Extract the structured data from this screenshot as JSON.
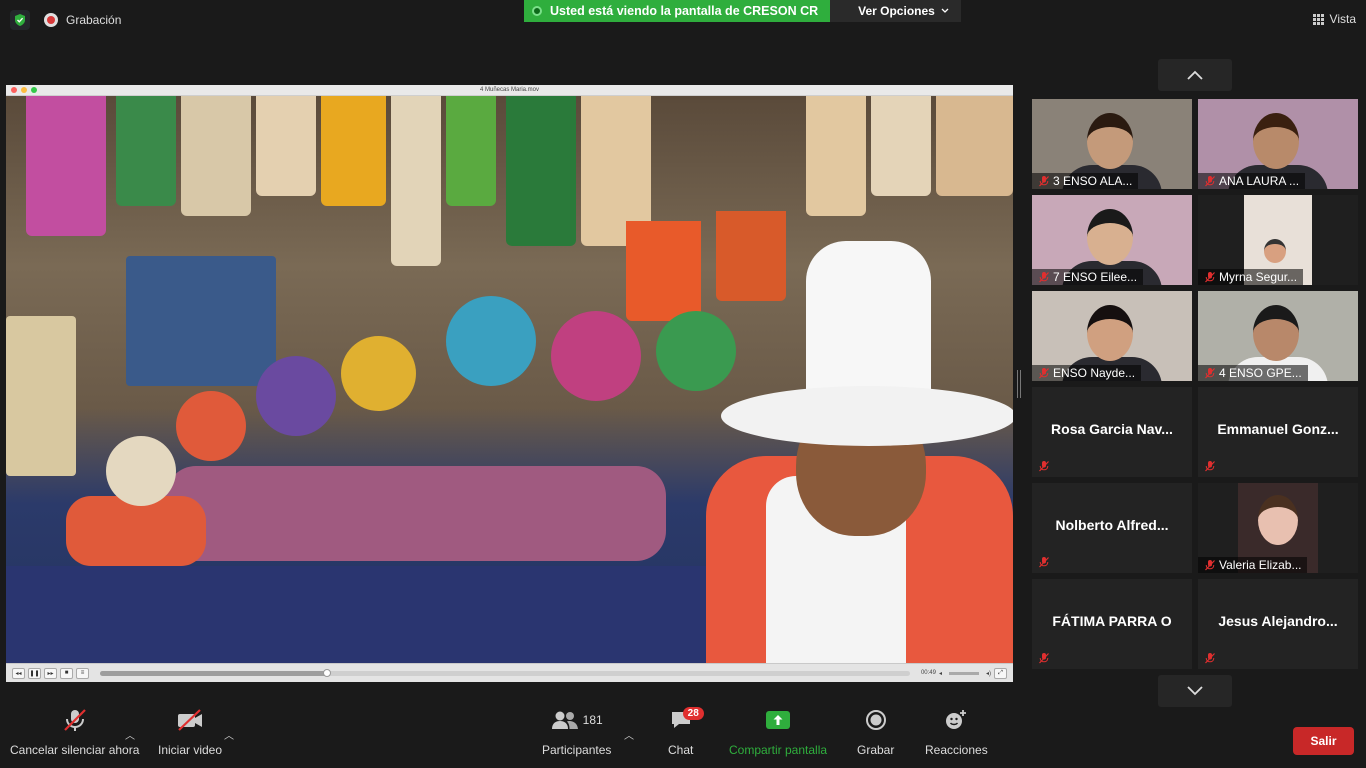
{
  "topbar": {
    "recording_label": "Grabación",
    "share_banner_text": "Usted está viendo la pantalla de CRESON CR",
    "view_options_label": "Ver Opciones",
    "view_label": "Vista"
  },
  "shared_window": {
    "title": "4 Muñecas Maria.mov",
    "time": "00:49",
    "progress": 0.28
  },
  "gallery": {
    "tiles": [
      {
        "name": "3 ENSO ALA...",
        "video": true,
        "muted": true
      },
      {
        "name": "ANA LAURA ...",
        "video": true,
        "muted": true
      },
      {
        "name": "7 ENSO Eilee...",
        "video": true,
        "muted": true
      },
      {
        "name": "Myrna Segur...",
        "video": true,
        "muted": true
      },
      {
        "name": "ENSO Nayde...",
        "video": true,
        "muted": true
      },
      {
        "name": "4 ENSO GPE...",
        "video": true,
        "muted": true
      },
      {
        "name": "Rosa Garcia Nav...",
        "video": false,
        "muted": true
      },
      {
        "name": "Emmanuel  Gonz...",
        "video": false,
        "muted": true
      },
      {
        "name": "Nolberto  Alfred...",
        "video": false,
        "muted": true
      },
      {
        "name": "Valeria Elizab...",
        "video": true,
        "muted": true
      },
      {
        "name": "FÁTIMA PARRA O",
        "video": false,
        "muted": true
      },
      {
        "name": "Jesus  Alejandro...",
        "video": false,
        "muted": true
      }
    ]
  },
  "toolbar": {
    "unmute_label": "Cancelar silenciar ahora",
    "video_label": "Iniciar video",
    "participants_label": "Participantes",
    "participants_count": "181",
    "chat_label": "Chat",
    "chat_badge": "28",
    "share_label": "Compartir pantalla",
    "record_label": "Grabar",
    "reactions_label": "Reacciones",
    "leave_label": "Salir"
  },
  "colors": {
    "share_green": "#2fae3d",
    "leave_red": "#c82828",
    "badge_red": "#e02f2f"
  }
}
